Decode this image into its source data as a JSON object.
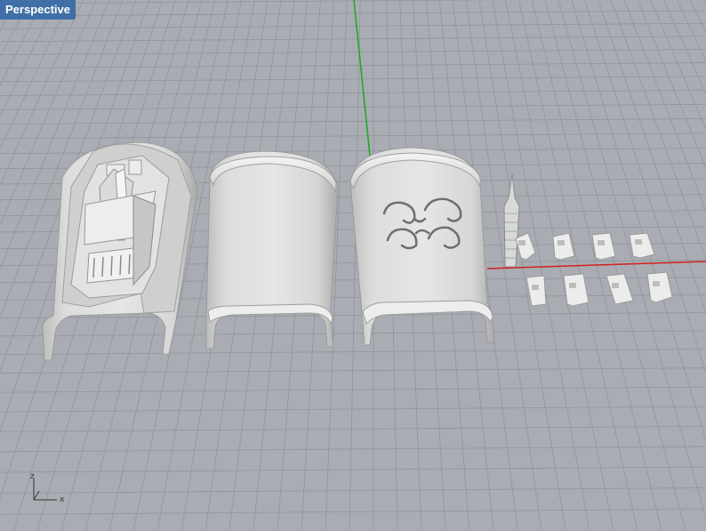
{
  "viewport": {
    "title": "Perspective",
    "background": "#a9adb3",
    "grid_color": "#8f949b",
    "x_axis_color": "#d22020",
    "y_axis_color": "#1ea51e"
  },
  "axis_gizmo": {
    "z_label": "z",
    "x_label": "x"
  },
  "parts": [
    {
      "name": "shell-with-castle-relief"
    },
    {
      "name": "plain-shell"
    },
    {
      "name": "shell-with-swirl-pattern"
    },
    {
      "name": "spire-post"
    },
    {
      "name": "small-clip"
    }
  ]
}
